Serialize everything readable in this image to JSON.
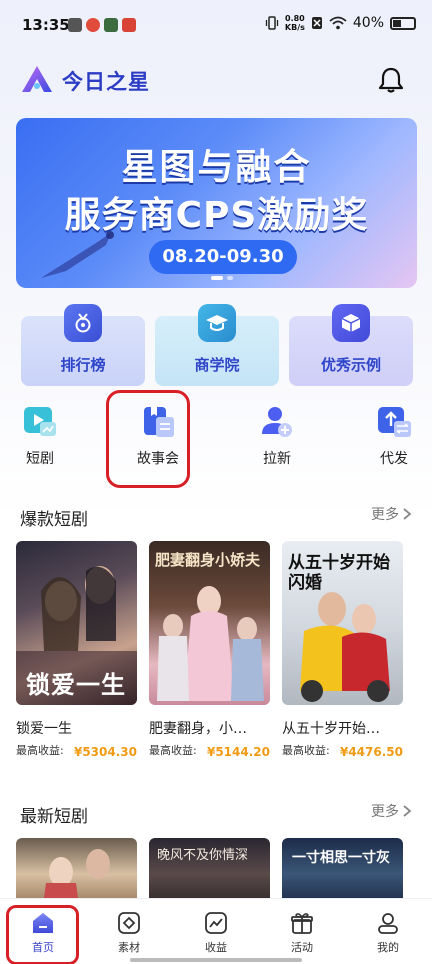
{
  "status_bar": {
    "time": "13:35",
    "net_speed_value": "0.80",
    "net_speed_unit": "KB/s",
    "battery": "40%"
  },
  "header": {
    "app_title": "今日之星",
    "logo_icon": "star-logo-icon",
    "bell_icon": "bell-icon"
  },
  "banner": {
    "line1": "星图与融合",
    "line2": "服务商CPS激励奖",
    "date_range": "08.20-09.30"
  },
  "quick_cards": [
    {
      "label": "排行榜",
      "icon": "medal-icon"
    },
    {
      "label": "商学院",
      "icon": "graduation-cap-icon"
    },
    {
      "label": "优秀示例",
      "icon": "cube-icon"
    }
  ],
  "features": [
    {
      "label": "短剧",
      "icon": "play-chart-icon"
    },
    {
      "label": "故事会",
      "icon": "book-icon"
    },
    {
      "label": "拉新",
      "icon": "add-user-icon"
    },
    {
      "label": "代发",
      "icon": "upload-swap-icon"
    }
  ],
  "hot_section": {
    "title": "爆款短剧",
    "more": "更多",
    "items": [
      {
        "name": "锁爱一生",
        "earn_label": "最高收益:",
        "earn_value": "¥5304.30",
        "poster_title": "锁爱一生"
      },
      {
        "name": "肥妻翻身，小…",
        "earn_label": "最高收益:",
        "earn_value": "¥5144.20",
        "poster_title": "肥妻翻身小娇夫"
      },
      {
        "name": "从五十岁开始…",
        "earn_label": "最高收益:",
        "earn_value": "¥4476.50",
        "poster_title": "从五十岁开始闪婚"
      }
    ]
  },
  "new_section": {
    "title": "最新短剧",
    "more": "更多",
    "items": [
      {
        "poster_title": ""
      },
      {
        "poster_title": "晚风不及你情深"
      },
      {
        "poster_title": "一寸相思一寸灰"
      }
    ]
  },
  "bottom_nav": [
    {
      "label": "首页",
      "icon": "home-icon",
      "active": true
    },
    {
      "label": "素材",
      "icon": "material-icon",
      "active": false
    },
    {
      "label": "收益",
      "icon": "earnings-chart-icon",
      "active": false
    },
    {
      "label": "活动",
      "icon": "gift-icon",
      "active": false
    },
    {
      "label": "我的",
      "icon": "profile-icon",
      "active": false
    }
  ],
  "colors": {
    "brand": "#2c3cc4",
    "earn": "#f19b14",
    "highlight": "#d81f26"
  }
}
